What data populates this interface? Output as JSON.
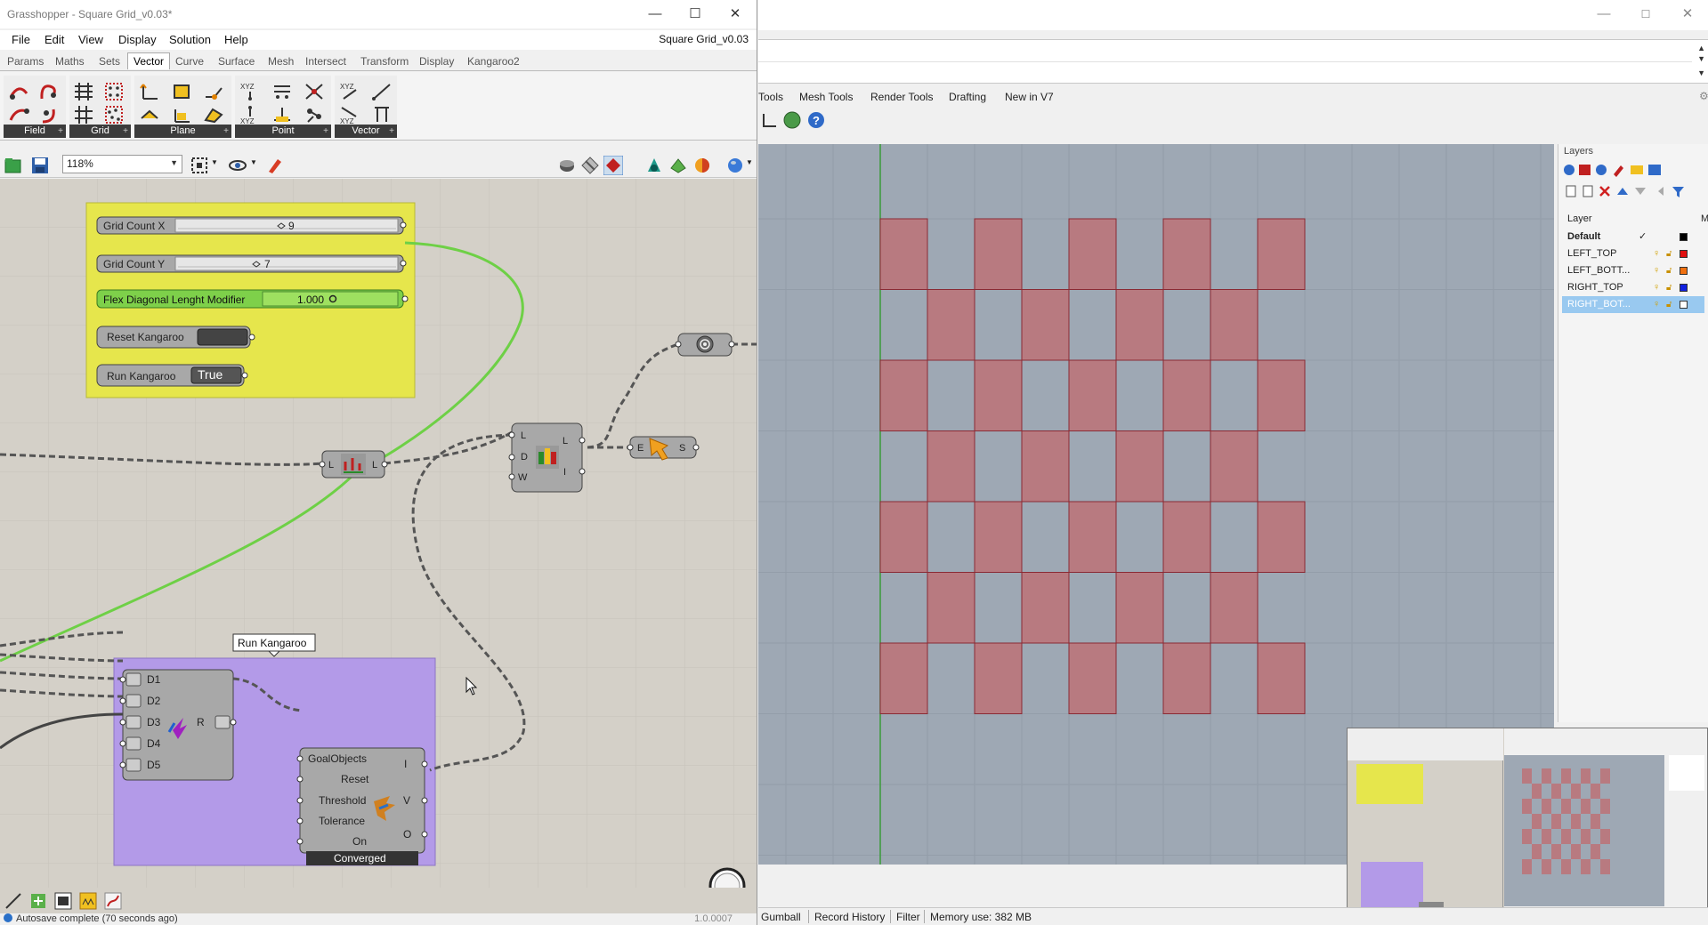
{
  "colors": {
    "canvas_bg": "#d4d0c8",
    "viewport_bg": "#9ea8b4",
    "cell_fill": "#b87a80",
    "group_yellow": "#e6e64c",
    "group_purple": "#b39ae8",
    "wire_green": "#6ed046",
    "slider_green": "#7ed04a",
    "layer_selected": "#99c9f0"
  },
  "grasshopper": {
    "title": "Grasshopper - Square Grid_v0.03*",
    "window_buttons": {
      "minimize": "—",
      "maximize": "☐",
      "close": "✕"
    },
    "doc_name": "Square Grid_v0.03",
    "menu": [
      "File",
      "Edit",
      "View",
      "Display",
      "Solution",
      "Help"
    ],
    "tabs": [
      "Params",
      "Maths",
      "Sets",
      "Vector",
      "Curve",
      "Surface",
      "Mesh",
      "Intersect",
      "Transform",
      "Display",
      "Kangaroo2"
    ],
    "active_tab": "Vector",
    "ribbon_groups": [
      "Field",
      "Grid",
      "Plane",
      "Point",
      "Vector"
    ],
    "zoom": "118%",
    "status": "Autosave complete (70 seconds ago)",
    "version": "1.0.0007"
  },
  "canvas": {
    "sliders": [
      {
        "label": "Grid Count X",
        "value": "9"
      },
      {
        "label": "Grid Count Y",
        "value": "7"
      },
      {
        "label": "Flex Diagonal Lenght Modifier",
        "value": "1.000"
      }
    ],
    "button": {
      "label": "Reset Kangaroo"
    },
    "toggle": {
      "label": "Run Kangaroo",
      "value": "True"
    },
    "group_label": "Run Kangaroo",
    "entwine": {
      "inputs": [
        "D1",
        "D2",
        "D3",
        "D4",
        "D5"
      ],
      "output": "R"
    },
    "solver": {
      "inputs": [
        "GoalObjects",
        "Reset",
        "Threshold",
        "Tolerance",
        "On"
      ],
      "outputs": [
        "I",
        "V",
        "O"
      ],
      "status": "Converged"
    },
    "flatten_node": {
      "input": "L",
      "output": "L"
    },
    "list_node": {
      "inputs": [
        "L",
        "D",
        "W"
      ],
      "outputs": [
        "L",
        "I"
      ]
    },
    "explode_node": {
      "input": "E",
      "output": "S"
    }
  },
  "rhino": {
    "tabs": [
      "Tools",
      "Mesh Tools",
      "Render Tools",
      "Drafting",
      "New in V7"
    ],
    "status_items": [
      "Gumball",
      "Record History",
      "Filter",
      "Memory use: 382 MB"
    ],
    "layers_panel": {
      "title": "Layers",
      "header": "Layer",
      "header_right": "M",
      "rows": [
        {
          "name": "Default",
          "color": "#000000",
          "current": true
        },
        {
          "name": "LEFT_TOP",
          "color": "#e01010"
        },
        {
          "name": "LEFT_BOTT...",
          "color": "#f07010"
        },
        {
          "name": "RIGHT_TOP",
          "color": "#1020e0"
        },
        {
          "name": "RIGHT_BOT...",
          "color": "#ffffff",
          "selected": true
        }
      ]
    }
  }
}
